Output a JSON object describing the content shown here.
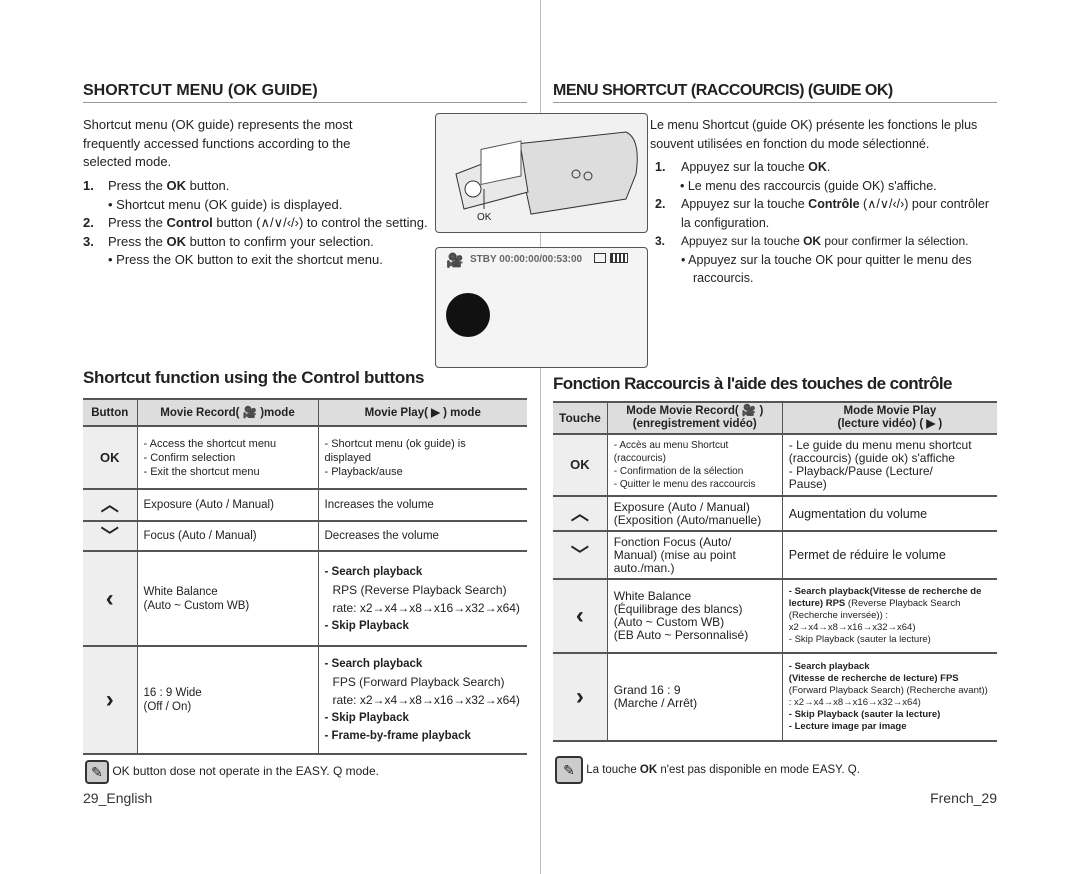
{
  "left": {
    "heading": "SHORTCUT MENU (OK GUIDE)",
    "intro": "Shortcut menu (OK guide) represents the most frequently accessed functions according to the selected mode.",
    "steps": [
      {
        "n": "1.",
        "pre": "Press the ",
        "b": "OK",
        "post": " button."
      },
      {
        "bullet": "• Shortcut menu (OK guide) is displayed."
      },
      {
        "n": "2.",
        "pre": "Press the ",
        "b": "Control",
        "post": " button (∧/∨/‹/›) to control the setting."
      },
      {
        "n": "3.",
        "pre": "Press the ",
        "b": "OK",
        "post": " button to confirm your selection."
      },
      {
        "bullet": "• Press the OK button to exit the shortcut menu."
      }
    ],
    "section_title": "Shortcut function using the Control buttons",
    "table": {
      "headers": [
        "Button",
        "Movie Record( 🎥 )mode",
        "Movie Play( ▶ ) mode"
      ],
      "rows": [
        {
          "button": "OK",
          "record": "- Access the shortcut menu\n- Confirm selection\n- Exit the shortcut menu",
          "play": "- Shortcut menu (ok guide)  is\n  displayed\n- Playback/ause"
        },
        {
          "button": "︿",
          "record": "Exposure (Auto / Manual)",
          "play": "Increases the volume"
        },
        {
          "button": "﹀",
          "record": "Focus (Auto / Manual)",
          "play": "Decreases the volume"
        },
        {
          "button": "‹",
          "record": "White Balance\n(Auto ~ Custom WB)",
          "play_b1": "- Search playback",
          "play_t1": "RPS (Reverse Playback Search) rate: x2→x4→x8→x16→x32→x64)",
          "play_b2": "- Skip Playback"
        },
        {
          "button": "›",
          "record": "16 : 9 Wide\n (Off / On)",
          "play_b1": "- Search playback",
          "play_t1": "FPS (Forward Playback Search) rate: x2→x4→x8→x16→x32→x64)",
          "play_b2": "- Skip Playback",
          "play_b3": "- Frame-by-frame playback"
        }
      ]
    },
    "note": "OK button dose not operate in the EASY. Q mode.",
    "footer": "29_English"
  },
  "right": {
    "heading": "MENU SHORTCUT (RACCOURCIS) (GUIDE OK)",
    "intro": "Le menu Shortcut (guide OK) présente les fonctions le plus souvent utilisées en fonction du mode sélectionné.",
    "steps": [
      {
        "n": "1.",
        "pre": "Appuyez sur la touche ",
        "b": "OK",
        "post": "."
      },
      {
        "bullet": "• Le menu des raccourcis (guide OK) s'affiche."
      },
      {
        "n": "2.",
        "pre": "Appuyez sur la touche ",
        "b": "Contrôle",
        "post": " (∧/∨/‹/›) pour contrôler la configuration."
      },
      {
        "n": "3.",
        "pre": "Appuyez sur la touche ",
        "b": "OK",
        "post": " pour confirmer la sélection."
      },
      {
        "bullet": "• Appuyez sur la touche OK pour quitter le menu des raccourcis."
      }
    ],
    "section_title": "Fonction Raccourcis à l'aide des touches de contrôle",
    "table": {
      "headers": [
        "Touche",
        "Mode Movie Record( 🎥 )\n(enregistrement vidéo)",
        "Mode Movie Play\n(lecture vidéo) ( ▶ )"
      ],
      "rows": [
        {
          "button": "OK",
          "record": "- Accès au menu Shortcut\n (raccourcis)\n- Confirmation de la sélection\n- Quitter le menu des raccourcis",
          "play": "- Le guide du menu menu shortcut\n  (raccourcis) (guide ok) s'affiche\n- Playback/Pause (Lecture/\n  Pause)"
        },
        {
          "button": "︿",
          "record": "Exposure (Auto / Manual)\n(Exposition (Auto/manuelle)",
          "play": "Augmentation du volume"
        },
        {
          "button": "﹀",
          "record": "Fonction Focus (Auto/\nManual) (mise au point\nauto./man.)",
          "play": "Permet de réduire le volume"
        },
        {
          "button": "‹",
          "record": "White Balance\n(Équilibrage des blancs)\n(Auto ~ Custom WB)\n(EB Auto ~ Personnalisé)",
          "play_b1": "- Search playback(Vitesse de recherche de lecture) RPS",
          "play_t1": " (Reverse Playback Search (Recherche inversée)) : x2→x4→x8→x16→x32→x64)",
          "play_b2": "- Skip Playback (sauter la lecture)"
        },
        {
          "button": "›",
          "record": "Grand 16 : 9\n (Marche / Arrêt)",
          "play_b1": "- Search playback\n(Vitesse de recherche de lecture)  FPS",
          "play_t1": "(Forward Playback Search) (Recherche avant)) : x2→x4→x8→x16→x32→x64)",
          "play_b2": "- Skip Playback (sauter la lecture)",
          "play_b3": "- Lecture image par image"
        }
      ]
    },
    "note_pre": "La touche ",
    "note_b": "OK",
    "note_post": " n'est pas disponible en mode EASY. Q.",
    "footer": "French_29"
  },
  "figure": {
    "ok_label": "OK",
    "lcd_status": "STBY 00:00:00/00:53:00"
  }
}
